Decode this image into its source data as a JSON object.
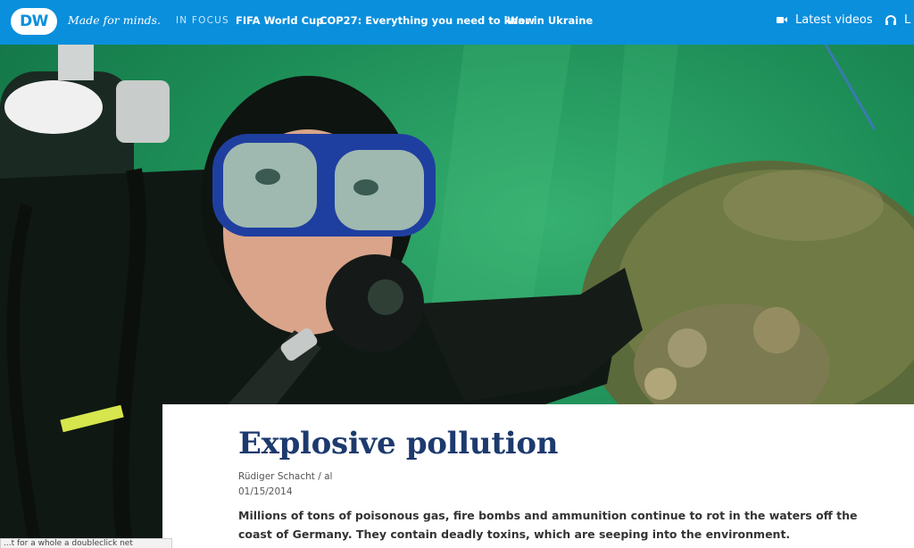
{
  "header": {
    "logo_text": "DW",
    "tagline": "Made for minds.",
    "focus_label": "IN FOCUS",
    "nav_links": [
      "FIFA World Cup",
      "COP27: Everything you need to know",
      "War in Ukraine"
    ],
    "latest_videos": "Latest videos",
    "live_label": "L",
    "latest_icon": "video-camera-icon",
    "live_icon": "headphones-icon",
    "bg_color": "#0a8fdc"
  },
  "hero": {
    "image_subject": "diver-with-munition-underwater",
    "dominant_color": "#1e8f58"
  },
  "article": {
    "title": "Explosive pollution",
    "author": "Rüdiger Schacht / al",
    "date": "01/15/2014",
    "teaser": "Millions of tons of poisonous gas, fire bombs and ammunition continue to rot in the waters off the coast of Germany. They contain deadly toxins, which are seeping into the environment.",
    "title_color": "#1d3a6e"
  },
  "tooltip": {
    "text": "...t for a whole a doubleclick net"
  }
}
